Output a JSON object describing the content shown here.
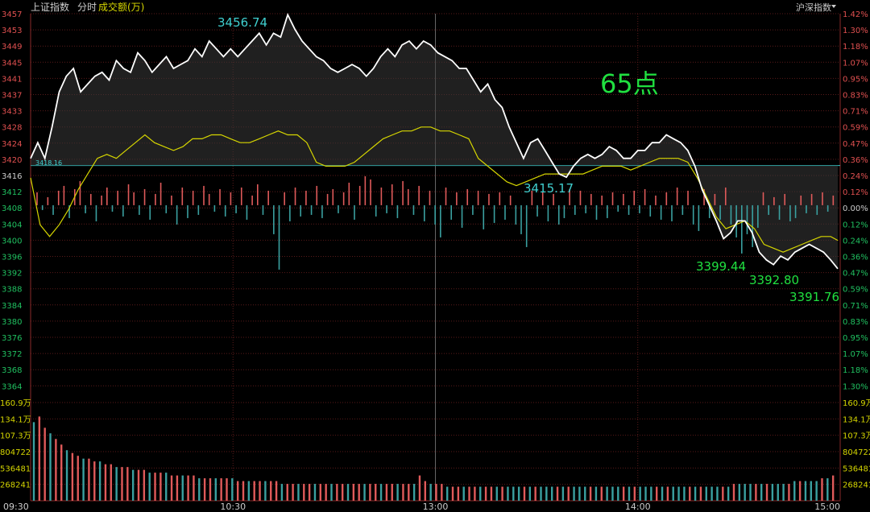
{
  "header": {
    "index_name": "上证指数",
    "mode": "分时",
    "volume_label": "成交额(万)",
    "right_label": "沪深指数"
  },
  "colors": {
    "background": "#000000",
    "price_line": "#ffffff",
    "avg_line": "#d6d600",
    "up": "#e05a5a",
    "down": "#3aa0a0",
    "grid": "#5a1a1a",
    "axis_red": "#e05050",
    "axis_green": "#20c060",
    "axis_cyan": "#30c8c8",
    "text_yellow": "#d6d600"
  },
  "annotations": {
    "big_label": "65点",
    "high": "3456.74",
    "low1": "3415.17",
    "low2": "3399.44",
    "low3": "3392.80",
    "low4": "3391.76",
    "prev_close_tag": "3418.16"
  },
  "chart_data": {
    "type": "line",
    "title": "",
    "prev_close": 3418.16,
    "ylim": [
      3360,
      3457
    ],
    "price_ticks": [
      3457,
      3453,
      3449,
      3445,
      3441,
      3437,
      3433,
      3428,
      3424,
      3420,
      3416,
      3412,
      3408,
      3404,
      3400,
      3396,
      3392,
      3388,
      3384,
      3380,
      3376,
      3372,
      3368,
      3364
    ],
    "pct_ticks": [
      "1.42%",
      "1.30%",
      "1.18%",
      "1.07%",
      "0.95%",
      "0.83%",
      "0.71%",
      "0.59%",
      "0.47%",
      "0.36%",
      "0.24%",
      "0.12%",
      "0.00%",
      "0.12%",
      "0.24%",
      "0.36%",
      "0.47%",
      "0.59%",
      "0.71%",
      "0.83%",
      "0.95%",
      "1.07%",
      "1.18%",
      "1.30%"
    ],
    "volume_ticks_left": [
      "160.9万",
      "134.1万",
      "107.3万",
      "804722",
      "536481",
      "268241"
    ],
    "volume_ticks_right": [
      "160.9万",
      "134.1万",
      "107.3万",
      "804722",
      "536481",
      "268241"
    ],
    "time_labels": [
      "09:30",
      "10:30",
      "13:00",
      "14:00",
      "15:00"
    ],
    "series": [
      {
        "key": "price",
        "points": [
          [
            0,
            3420
          ],
          [
            3,
            3424
          ],
          [
            6,
            3420
          ],
          [
            9,
            3428
          ],
          [
            12,
            3437
          ],
          [
            15,
            3441
          ],
          [
            18,
            3443
          ],
          [
            21,
            3437
          ],
          [
            24,
            3439
          ],
          [
            27,
            3441
          ],
          [
            30,
            3442
          ],
          [
            33,
            3440
          ],
          [
            36,
            3445
          ],
          [
            39,
            3443
          ],
          [
            42,
            3442
          ],
          [
            45,
            3447
          ],
          [
            48,
            3445
          ],
          [
            51,
            3442
          ],
          [
            54,
            3444
          ],
          [
            57,
            3446
          ],
          [
            60,
            3443
          ],
          [
            63,
            3444
          ],
          [
            66,
            3445
          ],
          [
            69,
            3448
          ],
          [
            72,
            3446
          ],
          [
            75,
            3450
          ],
          [
            78,
            3448
          ],
          [
            81,
            3446
          ],
          [
            84,
            3448
          ],
          [
            87,
            3446
          ],
          [
            90,
            3448
          ],
          [
            93,
            3450
          ],
          [
            96,
            3452
          ],
          [
            99,
            3449
          ],
          [
            102,
            3452
          ],
          [
            105,
            3451
          ],
          [
            108,
            3456.74
          ],
          [
            111,
            3453
          ],
          [
            114,
            3450
          ],
          [
            117,
            3448
          ],
          [
            120,
            3446
          ],
          [
            123,
            3445
          ],
          [
            126,
            3443
          ],
          [
            129,
            3442
          ],
          [
            132,
            3443
          ],
          [
            135,
            3444
          ],
          [
            138,
            3443
          ],
          [
            141,
            3441
          ],
          [
            144,
            3443
          ],
          [
            147,
            3446
          ],
          [
            150,
            3448
          ],
          [
            153,
            3446
          ],
          [
            156,
            3449
          ],
          [
            159,
            3450
          ],
          [
            162,
            3448
          ],
          [
            165,
            3450
          ],
          [
            168,
            3449
          ],
          [
            171,
            3447
          ],
          [
            174,
            3446
          ],
          [
            177,
            3445
          ],
          [
            180,
            3443
          ],
          [
            183,
            3443
          ],
          [
            186,
            3440
          ],
          [
            189,
            3437
          ],
          [
            192,
            3439
          ],
          [
            195,
            3435
          ],
          [
            198,
            3433
          ],
          [
            201,
            3428
          ],
          [
            204,
            3424
          ],
          [
            207,
            3420
          ],
          [
            210,
            3424
          ],
          [
            213,
            3425
          ],
          [
            216,
            3422
          ],
          [
            219,
            3419
          ],
          [
            222,
            3416
          ],
          [
            225,
            3415.17
          ],
          [
            228,
            3418
          ],
          [
            231,
            3420
          ],
          [
            234,
            3421
          ],
          [
            237,
            3420
          ],
          [
            240,
            3421
          ],
          [
            243,
            3423
          ],
          [
            246,
            3422
          ],
          [
            249,
            3420
          ],
          [
            252,
            3420
          ],
          [
            255,
            3422
          ],
          [
            258,
            3422
          ],
          [
            261,
            3424
          ],
          [
            264,
            3424
          ],
          [
            267,
            3426
          ],
          [
            270,
            3425
          ],
          [
            273,
            3424
          ],
          [
            276,
            3422
          ],
          [
            279,
            3418
          ],
          [
            282,
            3412
          ],
          [
            285,
            3408
          ],
          [
            288,
            3404
          ],
          [
            291,
            3399.44
          ],
          [
            294,
            3401
          ],
          [
            297,
            3404
          ],
          [
            300,
            3404
          ],
          [
            303,
            3401
          ],
          [
            306,
            3396
          ],
          [
            309,
            3394
          ],
          [
            312,
            3392.8
          ],
          [
            315,
            3395
          ],
          [
            318,
            3394
          ],
          [
            321,
            3396
          ],
          [
            324,
            3397
          ],
          [
            327,
            3398
          ],
          [
            330,
            3397
          ],
          [
            333,
            3396
          ],
          [
            336,
            3394
          ],
          [
            339,
            3391.76
          ]
        ]
      },
      {
        "key": "avg",
        "points": [
          [
            0,
            3415
          ],
          [
            4,
            3403
          ],
          [
            8,
            3400
          ],
          [
            12,
            3403
          ],
          [
            16,
            3407
          ],
          [
            20,
            3412
          ],
          [
            24,
            3416
          ],
          [
            28,
            3420
          ],
          [
            32,
            3421
          ],
          [
            36,
            3420
          ],
          [
            40,
            3422
          ],
          [
            44,
            3424
          ],
          [
            48,
            3426
          ],
          [
            52,
            3424
          ],
          [
            56,
            3423
          ],
          [
            60,
            3422
          ],
          [
            64,
            3423
          ],
          [
            68,
            3425
          ],
          [
            72,
            3425
          ],
          [
            76,
            3426
          ],
          [
            80,
            3426
          ],
          [
            84,
            3425
          ],
          [
            88,
            3424
          ],
          [
            92,
            3424
          ],
          [
            96,
            3425
          ],
          [
            100,
            3426
          ],
          [
            104,
            3427
          ],
          [
            108,
            3426
          ],
          [
            112,
            3426
          ],
          [
            116,
            3424
          ],
          [
            120,
            3419
          ],
          [
            124,
            3418
          ],
          [
            128,
            3418
          ],
          [
            132,
            3418
          ],
          [
            136,
            3419
          ],
          [
            140,
            3421
          ],
          [
            144,
            3423
          ],
          [
            148,
            3425
          ],
          [
            152,
            3426
          ],
          [
            156,
            3427
          ],
          [
            160,
            3427
          ],
          [
            164,
            3428
          ],
          [
            168,
            3428
          ],
          [
            172,
            3427
          ],
          [
            176,
            3427
          ],
          [
            180,
            3426
          ],
          [
            184,
            3425
          ],
          [
            188,
            3420
          ],
          [
            192,
            3418
          ],
          [
            196,
            3416
          ],
          [
            200,
            3414
          ],
          [
            204,
            3413
          ],
          [
            208,
            3414
          ],
          [
            212,
            3415
          ],
          [
            216,
            3416
          ],
          [
            220,
            3416
          ],
          [
            224,
            3416
          ],
          [
            228,
            3416
          ],
          [
            232,
            3416
          ],
          [
            236,
            3417
          ],
          [
            240,
            3418
          ],
          [
            244,
            3418
          ],
          [
            248,
            3418
          ],
          [
            252,
            3417
          ],
          [
            256,
            3418
          ],
          [
            260,
            3419
          ],
          [
            264,
            3420
          ],
          [
            268,
            3420
          ],
          [
            272,
            3420
          ],
          [
            276,
            3419
          ],
          [
            280,
            3415
          ],
          [
            284,
            3410
          ],
          [
            288,
            3405
          ],
          [
            292,
            3402
          ],
          [
            296,
            3403
          ],
          [
            300,
            3404
          ],
          [
            304,
            3402
          ],
          [
            308,
            3398
          ],
          [
            312,
            3397
          ],
          [
            316,
            3396
          ],
          [
            320,
            3397
          ],
          [
            324,
            3398
          ],
          [
            328,
            3399
          ],
          [
            332,
            3400
          ],
          [
            336,
            3400
          ],
          [
            339,
            3399
          ]
        ]
      }
    ],
    "bars": [
      8,
      -3,
      5,
      -6,
      9,
      12,
      -8,
      10,
      15,
      -5,
      7,
      -10,
      6,
      11,
      -4,
      9,
      -7,
      13,
      8,
      -6,
      10,
      -9,
      7,
      14,
      -5,
      6,
      -12,
      11,
      -8,
      9,
      -6,
      12,
      7,
      -4,
      10,
      -7,
      8,
      -5,
      11,
      -9,
      6,
      13,
      -6,
      9,
      -18,
      -40,
      8,
      -10,
      11,
      -7,
      9,
      -6,
      12,
      -8,
      7,
      10,
      -5,
      8,
      14,
      -9,
      12,
      18,
      16,
      -7,
      11,
      -5,
      13,
      -8,
      15,
      10,
      -6,
      12,
      -10,
      9,
      -12,
      -20,
      11,
      -9,
      8,
      -14,
      10,
      -6,
      9,
      -15,
      7,
      -11,
      8,
      -9,
      6,
      -12,
      -18,
      -26,
      9,
      -7,
      8,
      -10,
      7,
      -12,
      -8,
      10,
      -6,
      9,
      -5,
      7,
      -9,
      6,
      -8,
      8,
      -4,
      7,
      -6,
      9,
      -5,
      10,
      -7,
      6,
      -9,
      8,
      -10,
      11,
      -6,
      9,
      -12,
      -16,
      10,
      -8,
      7,
      -9,
      11,
      -12,
      -20,
      -30,
      -18,
      -26,
      -14,
      8,
      -6,
      5,
      -9,
      7,
      -10,
      -8,
      6,
      -5,
      7,
      -6,
      8,
      -4,
      6
    ],
    "volumes": [
      28,
      30,
      26,
      24,
      22,
      20,
      18,
      17,
      16,
      15,
      15,
      14,
      14,
      13,
      13,
      12,
      12,
      12,
      11,
      11,
      11,
      10,
      10,
      10,
      10,
      9,
      9,
      9,
      9,
      9,
      8,
      8,
      8,
      8,
      8,
      8,
      8,
      7,
      7,
      7,
      7,
      7,
      7,
      7,
      7,
      6,
      6,
      6,
      6,
      6,
      6,
      6,
      6,
      6,
      6,
      6,
      6,
      6,
      6,
      6,
      6,
      6,
      6,
      6,
      6,
      6,
      6,
      6,
      6,
      6,
      9,
      7,
      6,
      6,
      6,
      5,
      5,
      5,
      5,
      5,
      5,
      5,
      5,
      5,
      5,
      5,
      5,
      5,
      5,
      5,
      5,
      5,
      5,
      5,
      5,
      5,
      5,
      5,
      5,
      5,
      5,
      5,
      5,
      5,
      5,
      5,
      5,
      5,
      5,
      5,
      5,
      5,
      5,
      5,
      5,
      5,
      5,
      5,
      5,
      5,
      5,
      5,
      5,
      5,
      5,
      5,
      5,
      6,
      6,
      6,
      6,
      6,
      6,
      6,
      6,
      6,
      6,
      6,
      7,
      7,
      7,
      7,
      7,
      8,
      8,
      9
    ]
  }
}
